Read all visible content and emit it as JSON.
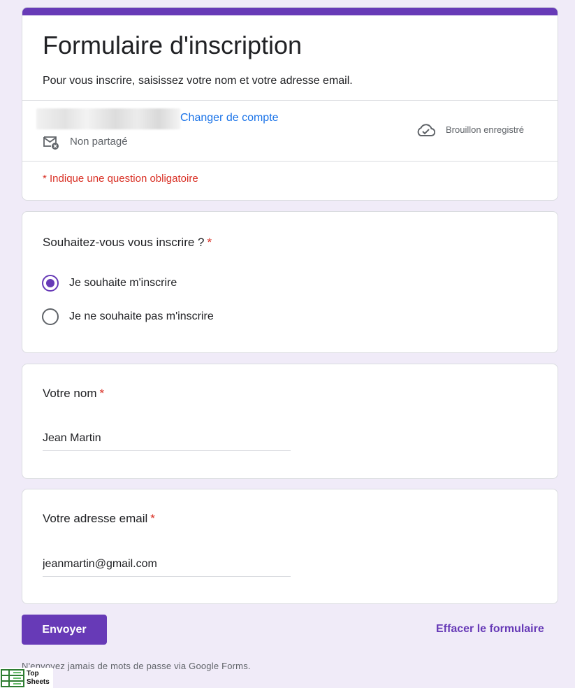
{
  "header": {
    "title": "Formulaire d'inscription",
    "description": "Pour vous inscrire, saisissez votre nom et votre adresse email.",
    "switch_account": "Changer de compte",
    "not_shared": "Non partagé",
    "draft_status": "Brouillon enregistré",
    "required_note": "* Indique une question obligatoire"
  },
  "question_signup": {
    "title": "Souhaitez-vous vous inscrire ?",
    "required_mark": "*",
    "options": [
      {
        "label": "Je souhaite m'inscrire",
        "selected": true
      },
      {
        "label": "Je ne souhaite pas m'inscrire",
        "selected": false
      }
    ]
  },
  "question_name": {
    "title": "Votre nom",
    "required_mark": "*",
    "value": "Jean Martin"
  },
  "question_email": {
    "title": "Votre adresse email",
    "required_mark": "*",
    "value": "jeanmartin@gmail.com"
  },
  "actions": {
    "submit_label": "Envoyer",
    "clear_label": "Effacer le formulaire"
  },
  "footer": {
    "note": "N'envoyez jamais de mots de passe via Google Forms."
  },
  "watermark": {
    "line1": "Top",
    "line2": "Sheets"
  },
  "colors": {
    "accent": "#673ab7",
    "background": "#f0ebf8",
    "link": "#1a73e8",
    "required": "#d93025"
  }
}
